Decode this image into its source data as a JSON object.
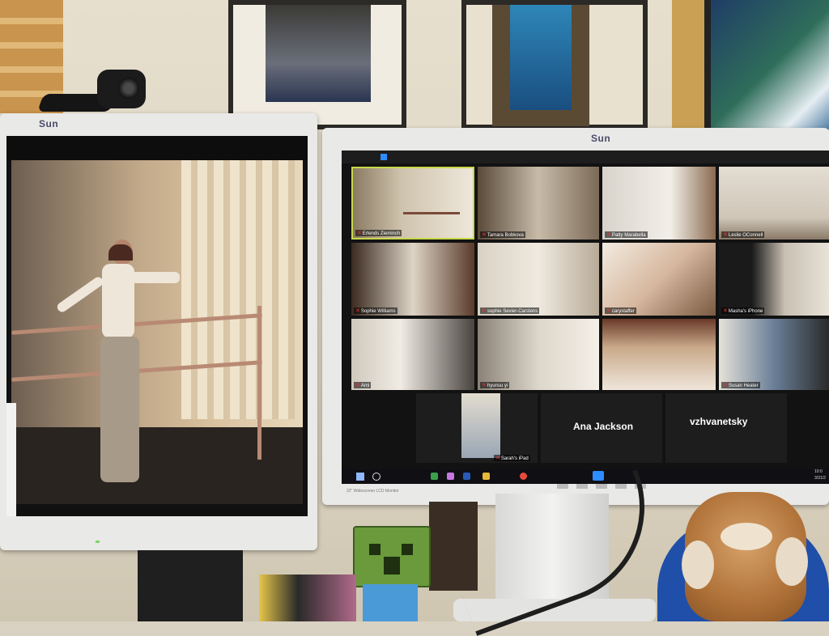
{
  "scene": {
    "left_monitor": {
      "brand": "Sun"
    },
    "right_monitor": {
      "brand": "Sun",
      "model_label": "22\" Widescreen LCD Monitor"
    }
  },
  "zoom_gallery": {
    "participants": [
      {
        "name": "Erlends Zieminch"
      },
      {
        "name": "Tamara Bobkova"
      },
      {
        "name": "Patty Marabella"
      },
      {
        "name": "Leslie OConnell"
      },
      {
        "name": "Sophie Williams"
      },
      {
        "name": "sophie Sevier-Carstens"
      },
      {
        "name": "carystaffer"
      },
      {
        "name": "Masha's iPhone"
      },
      {
        "name": "Ami"
      },
      {
        "name": "hyunsu yi"
      },
      {
        "name": "Susan Heater"
      },
      {
        "name": "Sarah's iPad"
      }
    ],
    "camera_off": [
      {
        "name": "Ana Jackson"
      },
      {
        "name": "vzhvanetsky"
      }
    ]
  },
  "taskbar": {
    "clock_time": "10:0",
    "clock_date": "3/31/2"
  },
  "colors": {
    "zoom_bg": "#1a1a1a",
    "active_speaker_border": "#c8d84a",
    "mute_icon": "#e33333",
    "sun_logo": "#4a4a6a"
  }
}
